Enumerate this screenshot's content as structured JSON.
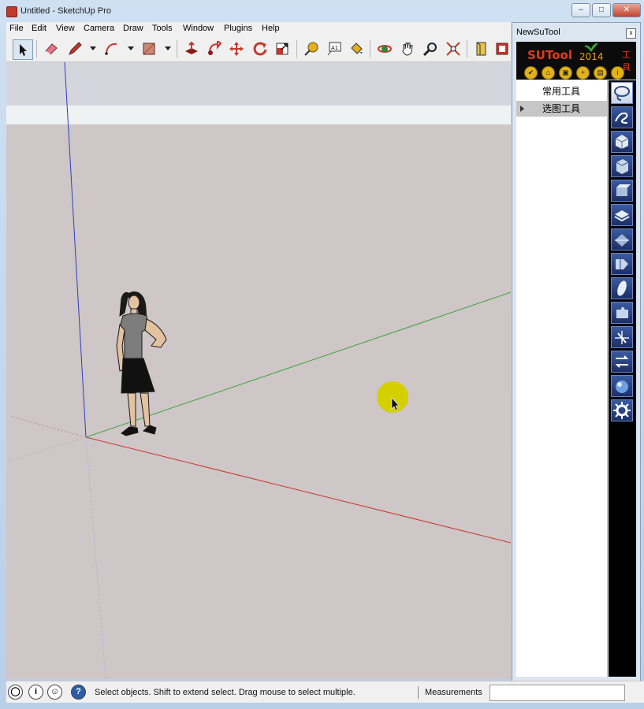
{
  "window": {
    "title": "Untitled - SketchUp Pro"
  },
  "menubar": {
    "items": [
      "File",
      "Edit",
      "View",
      "Camera",
      "Draw",
      "Tools",
      "Window",
      "Plugins",
      "Help"
    ]
  },
  "toolbar": {
    "tools": [
      "select-arrow-icon",
      "eraser-icon",
      "pencil-line-icon",
      "arc-icon",
      "rectangle-icon",
      "push-pull-icon",
      "follow-me-icon",
      "move-icon",
      "rotate-icon",
      "scale-icon",
      "tape-measure-icon",
      "text-label-icon",
      "paint-bucket-icon",
      "orbit-icon",
      "pan-hand-icon",
      "zoom-icon",
      "zoom-extents-icon",
      "section-plane-icon",
      "components-icon"
    ]
  },
  "panel": {
    "title": "NewSuTool",
    "close": "x",
    "brand": {
      "logo": "SUTool",
      "year": "2014",
      "label": "工具"
    },
    "buttons": [
      "✔",
      "⌂",
      "▣",
      "+",
      "▤",
      "i"
    ],
    "tree": [
      {
        "label": "常用工具",
        "selected": false
      },
      {
        "label": "选图工具",
        "selected": true
      }
    ],
    "icons": [
      "lasso-icon",
      "curve-icon",
      "cube-icon",
      "box-icon",
      "solid-icon",
      "stack-icon",
      "plane-icon",
      "mirror-icon",
      "surface-icon",
      "puzzle-icon",
      "scissors-icon",
      "arrows-icon",
      "sphere-icon",
      "gear-icon"
    ]
  },
  "statusbar": {
    "icons": [
      "geo-location-icon",
      "credits-icon",
      "user-account-icon",
      "help-icon"
    ],
    "text": "Select objects. Shift to extend select. Drag mouse to select multiple.",
    "measurements_label": "Measurements",
    "measurements_value": ""
  },
  "colors": {
    "axis_red": "#c0392b",
    "axis_green": "#3aa63a",
    "axis_blue": "#2e3fbf",
    "ground": "#cfc6c7",
    "cursor_highlight": "#d4d000"
  }
}
